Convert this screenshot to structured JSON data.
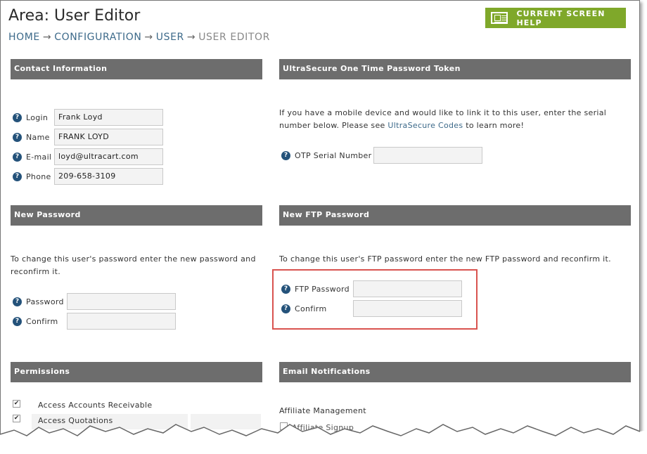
{
  "page": {
    "title": "Area: User Editor",
    "breadcrumb": [
      "HOME",
      "CONFIGURATION",
      "USER",
      "USER EDITOR"
    ],
    "separator": "→",
    "help_button": "CURRENT SCREEN HELP"
  },
  "contact": {
    "header": "Contact Information",
    "fields": [
      {
        "label": "Login",
        "value": "Frank Loyd"
      },
      {
        "label": "Name",
        "value": "FRANK LOYD"
      },
      {
        "label": "E-mail",
        "value": "loyd@ultracart.com"
      },
      {
        "label": "Phone",
        "value": "209-658-3109"
      }
    ]
  },
  "otp": {
    "header": "UltraSecure One Time Password Token",
    "text_before": "If you have a mobile device and would like to link it to this user, enter the serial number below. Please see ",
    "link": "UltraSecure Codes",
    "text_after": " to learn more!",
    "field_label": "OTP Serial Number",
    "field_value": ""
  },
  "new_password": {
    "header": "New Password",
    "text": "To change this user's password enter the new password and reconfirm it.",
    "fields": [
      {
        "label": "Password",
        "value": ""
      },
      {
        "label": "Confirm",
        "value": ""
      }
    ]
  },
  "ftp_password": {
    "header": "New FTP Password",
    "text": "To change this user's FTP password enter the new FTP password and reconfirm it.",
    "fields": [
      {
        "label": "FTP Password",
        "value": ""
      },
      {
        "label": "Confirm",
        "value": ""
      }
    ]
  },
  "permissions": {
    "header": "Permissions",
    "items": [
      {
        "label": "Access Accounts Receivable",
        "checked": true
      },
      {
        "label": "Access Quotations",
        "checked": true
      }
    ]
  },
  "email_notifications": {
    "header": "Email Notifications",
    "group": "Affiliate Management",
    "item": "Affiliate Signup"
  },
  "colors": {
    "header_bg": "#6d6d6d",
    "help_button": "#7fa82a",
    "link": "#3d6a8a",
    "highlight": "#d9534f",
    "help_icon": "#24527a"
  }
}
